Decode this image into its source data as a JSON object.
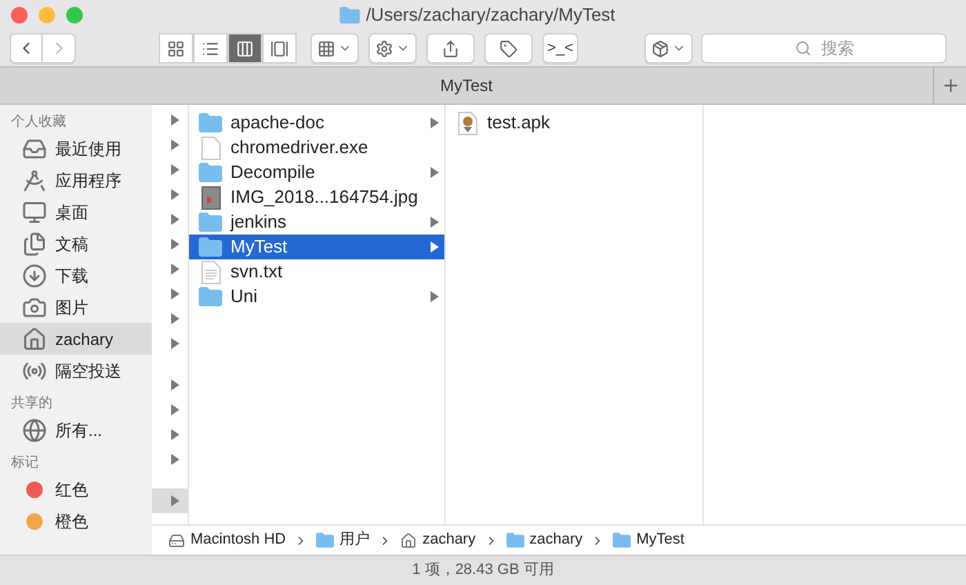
{
  "window": {
    "title": "/Users/zachary/zachary/MyTest"
  },
  "toolbar": {
    "back_disabled": false,
    "forward_disabled": true,
    "view_modes": [
      {
        "kind": "icons",
        "selected": false
      },
      {
        "kind": "list",
        "selected": false
      },
      {
        "kind": "columns",
        "selected": true
      },
      {
        "kind": "gallery",
        "selected": false
      }
    ],
    "terminal_label": ">_<",
    "search": {
      "placeholder": "搜索"
    }
  },
  "tabs": [
    {
      "label": "MyTest",
      "selected": true
    }
  ],
  "sidebar": {
    "sections": [
      {
        "title": "个人收藏",
        "items": [
          {
            "label": "最近使用",
            "kind": "recents",
            "selected": false
          },
          {
            "label": "应用程序",
            "kind": "apps",
            "selected": false
          },
          {
            "label": "桌面",
            "kind": "desktop",
            "selected": false
          },
          {
            "label": "文稿",
            "kind": "documents",
            "selected": false
          },
          {
            "label": "下载",
            "kind": "downloads",
            "selected": false
          },
          {
            "label": "图片",
            "kind": "pictures",
            "selected": false
          },
          {
            "label": "zachary",
            "kind": "home",
            "selected": true
          },
          {
            "label": "隔空投送",
            "kind": "airdrop",
            "selected": false
          }
        ]
      },
      {
        "title": "共享的",
        "items": [
          {
            "label": "所有...",
            "kind": "network",
            "selected": false
          }
        ]
      },
      {
        "title": "标记",
        "items": [
          {
            "label": "红色",
            "kind": "tag",
            "color": "#ef5b54",
            "selected": false
          },
          {
            "label": "橙色",
            "kind": "tag",
            "color": "#f2a548",
            "selected": false
          }
        ]
      }
    ]
  },
  "column_1": {
    "groups": [
      {
        "rows": [
          {
            "selected": false
          },
          {
            "selected": false
          },
          {
            "selected": false
          },
          {
            "selected": false
          },
          {
            "selected": false
          },
          {
            "selected": false
          },
          {
            "selected": false
          },
          {
            "selected": false
          },
          {
            "selected": false
          },
          {
            "selected": false
          }
        ]
      },
      {
        "rows": [
          {
            "selected": false
          },
          {
            "selected": false
          },
          {
            "selected": false
          },
          {
            "selected": false
          }
        ]
      },
      {
        "rows": [
          {
            "selected": true
          }
        ]
      }
    ]
  },
  "column_2": {
    "rows": [
      {
        "name": "apache-doc",
        "kind": "folder",
        "arrow": true,
        "selected": false
      },
      {
        "name": "chromedriver.exe",
        "kind": "document",
        "arrow": false,
        "selected": false
      },
      {
        "name": "Decompile",
        "kind": "folder",
        "arrow": true,
        "selected": false
      },
      {
        "name": "IMG_2018...164754.jpg",
        "kind": "image",
        "arrow": false,
        "selected": false
      },
      {
        "name": "jenkins",
        "kind": "folder",
        "arrow": true,
        "selected": false
      },
      {
        "name": "MyTest",
        "kind": "folder",
        "arrow": true,
        "selected": true
      },
      {
        "name": "svn.txt",
        "kind": "text",
        "arrow": false,
        "selected": false
      },
      {
        "name": "Uni",
        "kind": "folder",
        "arrow": true,
        "selected": false
      }
    ]
  },
  "column_3": {
    "rows": [
      {
        "name": "test.apk",
        "kind": "package",
        "arrow": false,
        "selected": false
      }
    ]
  },
  "path_bar": [
    {
      "label": "Macintosh HD",
      "kind": "disk"
    },
    {
      "label": "用户",
      "kind": "users"
    },
    {
      "label": "zachary",
      "kind": "home"
    },
    {
      "label": "zachary",
      "kind": "folder"
    },
    {
      "label": "MyTest",
      "kind": "folder"
    }
  ],
  "status_bar": "1 项，28.43 GB 可用"
}
